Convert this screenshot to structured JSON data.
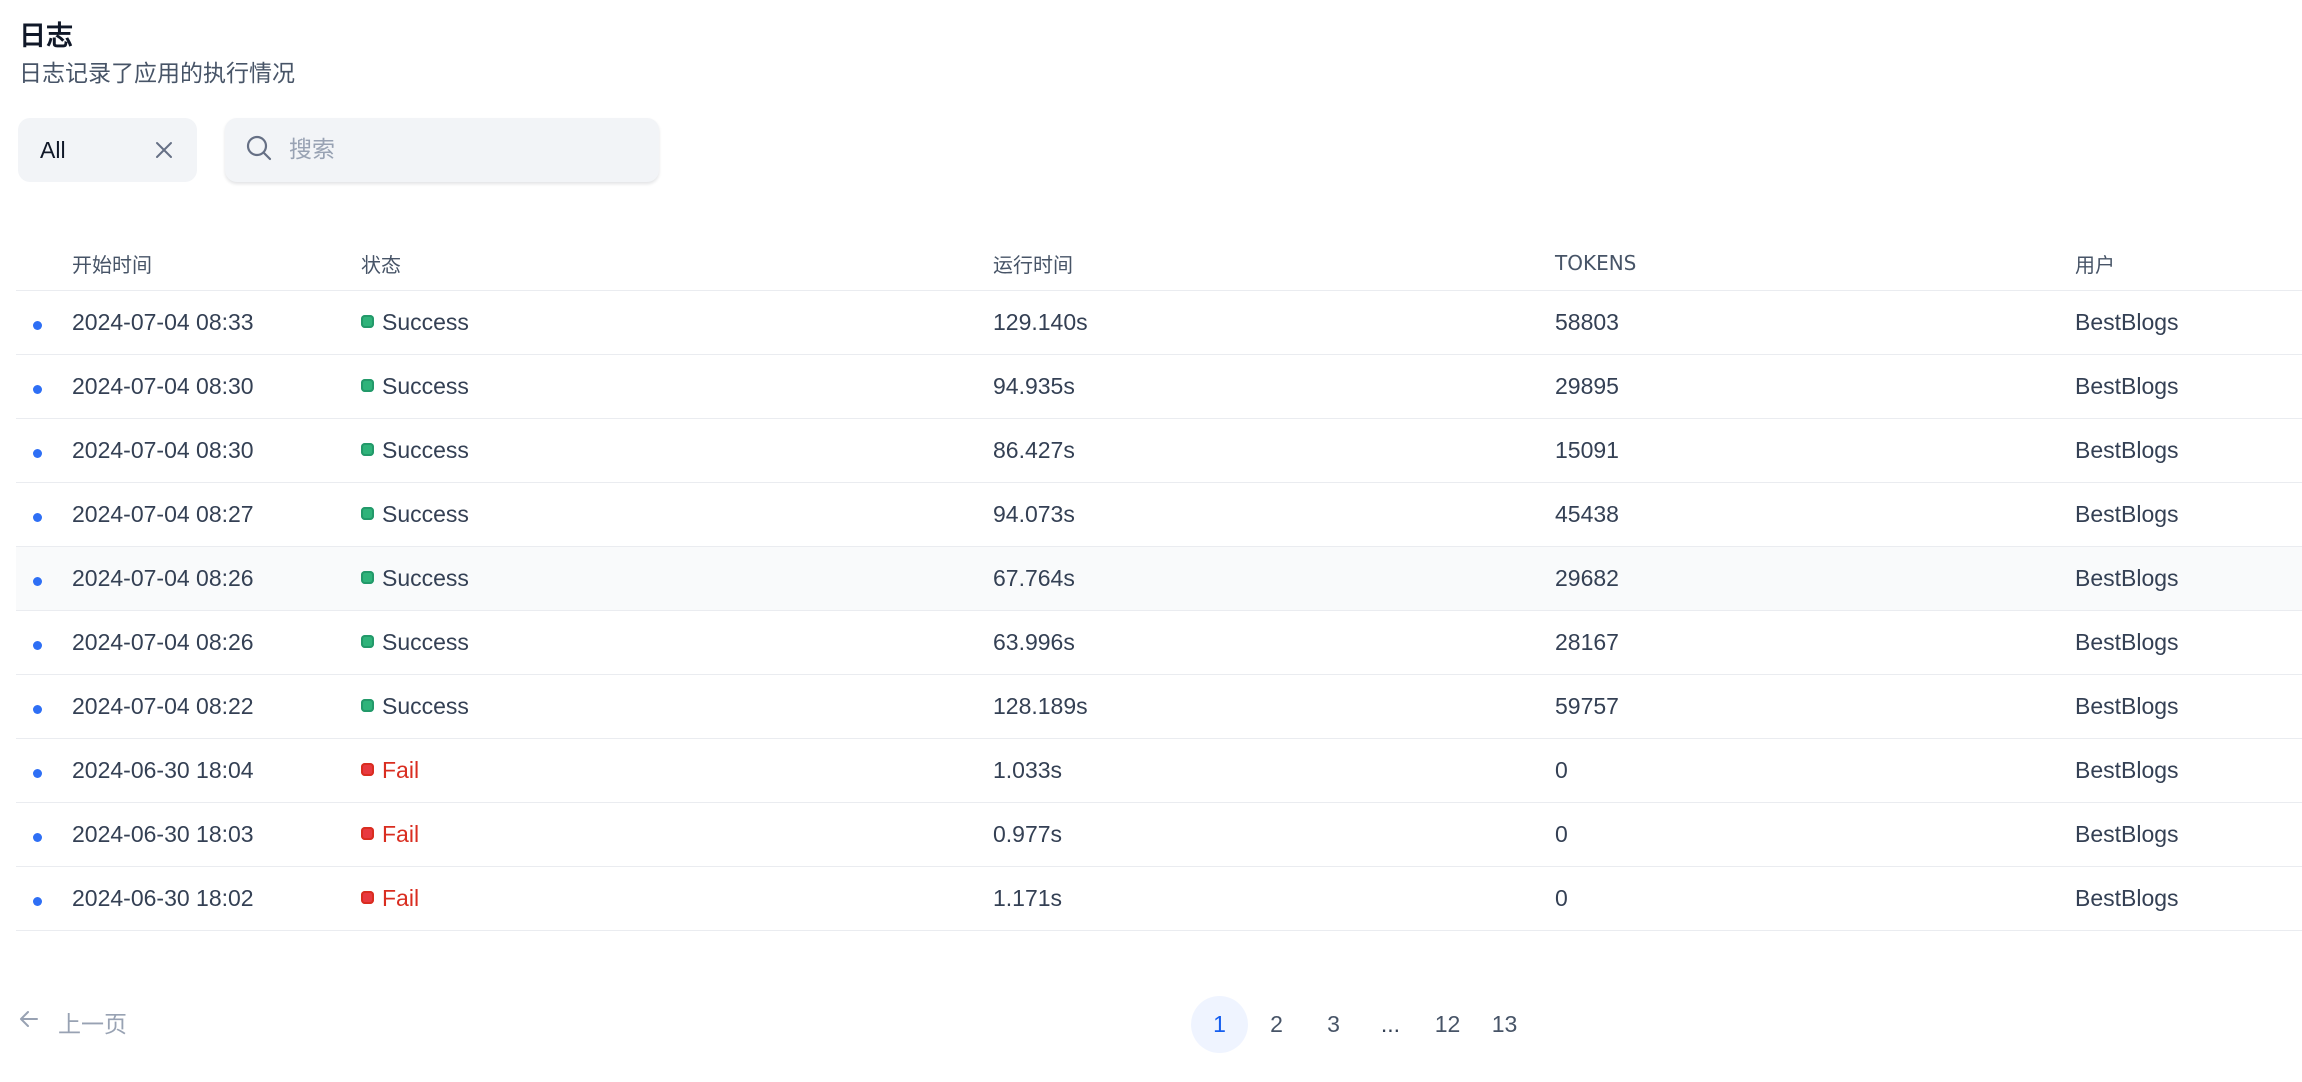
{
  "header": {
    "title": "日志",
    "subtitle": "日志记录了应用的执行情况"
  },
  "filters": {
    "status_value": "All",
    "search_placeholder": "搜索"
  },
  "table": {
    "columns": [
      "开始时间",
      "状态",
      "运行时间",
      "TOKENS",
      "用户"
    ],
    "rows": [
      {
        "start_time": "2024-07-04 08:33",
        "status": "Success",
        "status_kind": "success",
        "run_time": "129.140s",
        "tokens": "58803",
        "user": "BestBlogs"
      },
      {
        "start_time": "2024-07-04 08:30",
        "status": "Success",
        "status_kind": "success",
        "run_time": "94.935s",
        "tokens": "29895",
        "user": "BestBlogs"
      },
      {
        "start_time": "2024-07-04 08:30",
        "status": "Success",
        "status_kind": "success",
        "run_time": "86.427s",
        "tokens": "15091",
        "user": "BestBlogs"
      },
      {
        "start_time": "2024-07-04 08:27",
        "status": "Success",
        "status_kind": "success",
        "run_time": "94.073s",
        "tokens": "45438",
        "user": "BestBlogs"
      },
      {
        "start_time": "2024-07-04 08:26",
        "status": "Success",
        "status_kind": "success",
        "run_time": "67.764s",
        "tokens": "29682",
        "user": "BestBlogs"
      },
      {
        "start_time": "2024-07-04 08:26",
        "status": "Success",
        "status_kind": "success",
        "run_time": "63.996s",
        "tokens": "28167",
        "user": "BestBlogs"
      },
      {
        "start_time": "2024-07-04 08:22",
        "status": "Success",
        "status_kind": "success",
        "run_time": "128.189s",
        "tokens": "59757",
        "user": "BestBlogs"
      },
      {
        "start_time": "2024-06-30 18:04",
        "status": "Fail",
        "status_kind": "fail",
        "run_time": "1.033s",
        "tokens": "0",
        "user": "BestBlogs"
      },
      {
        "start_time": "2024-06-30 18:03",
        "status": "Fail",
        "status_kind": "fail",
        "run_time": "0.977s",
        "tokens": "0",
        "user": "BestBlogs"
      },
      {
        "start_time": "2024-06-30 18:02",
        "status": "Fail",
        "status_kind": "fail",
        "run_time": "1.171s",
        "tokens": "0",
        "user": "BestBlogs"
      }
    ]
  },
  "pagination": {
    "prev_label": "上一页",
    "pages": [
      "1",
      "2",
      "3",
      "...",
      "12",
      "13"
    ],
    "current_page": "1"
  },
  "colors": {
    "success": "#2fb37a",
    "fail": "#d92d20",
    "accent": "#155eef",
    "unread_dot": "#2e6ff5"
  },
  "icons": {
    "clear": "close-icon",
    "search": "search-icon",
    "prev": "arrow-left-icon"
  }
}
